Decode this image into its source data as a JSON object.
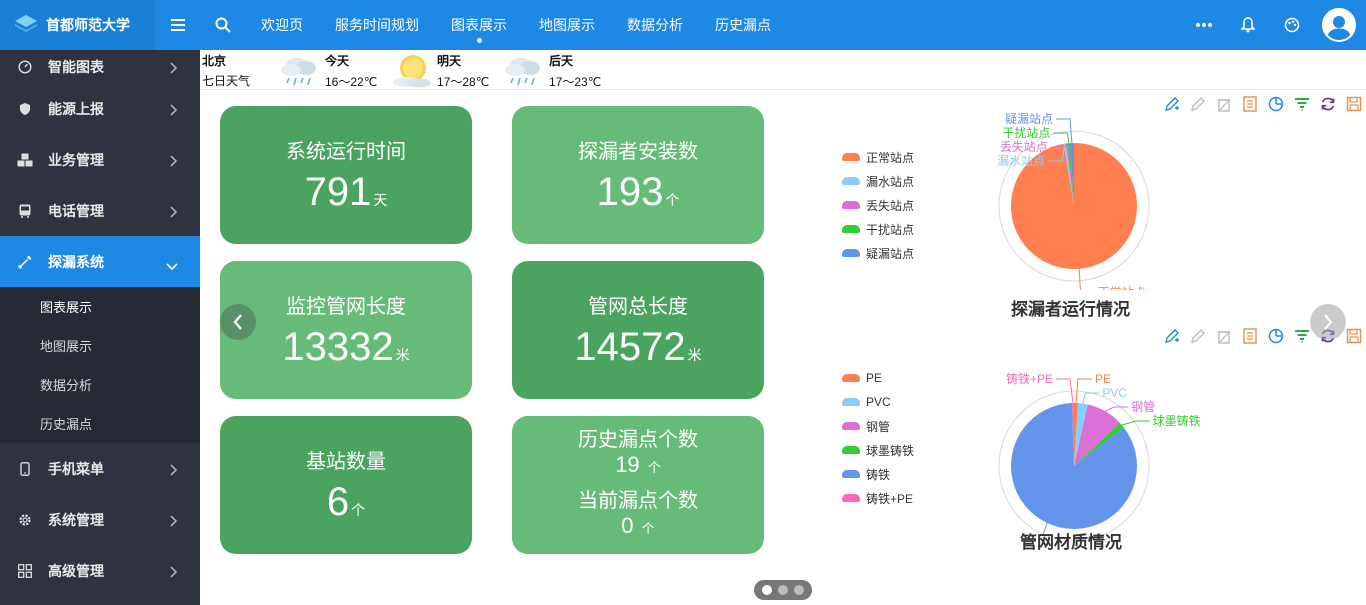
{
  "brand": {
    "name": "首都师范大学"
  },
  "nav": [
    {
      "label": "欢迎页"
    },
    {
      "label": "服务时间规划"
    },
    {
      "label": "图表展示",
      "active": true
    },
    {
      "label": "地图展示"
    },
    {
      "label": "数据分析"
    },
    {
      "label": "历史漏点"
    }
  ],
  "sidebar": {
    "items": [
      {
        "label": "智能图表",
        "icon": "gauge-icon"
      },
      {
        "label": "能源上报",
        "icon": "shield-icon"
      },
      {
        "label": "业务管理",
        "icon": "cubes-icon"
      },
      {
        "label": "电话管理",
        "icon": "bus-icon"
      },
      {
        "label": "探漏系统",
        "icon": "wrench-icon",
        "active": true
      },
      {
        "label": "手机菜单",
        "icon": "mobile-icon"
      },
      {
        "label": "系统管理",
        "icon": "gear-icon"
      },
      {
        "label": "高级管理",
        "icon": "grid-icon"
      }
    ],
    "sub_items": [
      {
        "label": "图表展示",
        "current": true
      },
      {
        "label": "地图展示"
      },
      {
        "label": "数据分析"
      },
      {
        "label": "历史漏点"
      }
    ]
  },
  "weather": {
    "city": "北京",
    "subtitle": "七日天气",
    "days": [
      {
        "name": "今天",
        "temp": "16～22℃",
        "icon": "rain-cloud-icon"
      },
      {
        "name": "明天",
        "temp": "17～28℃",
        "icon": "sun-cloud-icon"
      },
      {
        "name": "后天",
        "temp": "17～23℃",
        "icon": "rain-cloud-icon"
      }
    ]
  },
  "cards": {
    "uptime": {
      "title": "系统运行时间",
      "value": "791",
      "unit": "天"
    },
    "installs": {
      "title": "探漏者安装数",
      "value": "193",
      "unit": "个"
    },
    "monitor_length": {
      "title": "监控管网长度",
      "value": "13332",
      "unit": "米"
    },
    "total_length": {
      "title": "管网总长度",
      "value": "14572",
      "unit": "米"
    },
    "stations": {
      "title": "基站数量",
      "value": "6",
      "unit": "个"
    },
    "leaks": {
      "history_title": "历史漏点个数",
      "history_value": "19",
      "history_unit": "个",
      "current_title": "当前漏点个数",
      "current_value": "0",
      "current_unit": "个"
    }
  },
  "colors": {
    "topbar": "#1e88e5",
    "card_dark": "#4aa460",
    "card_light": "#66bb78"
  },
  "chart_data": [
    {
      "type": "pie",
      "title": "探漏者运行情况",
      "categories": [
        "正常站点",
        "漏水站点",
        "丢失站点",
        "干扰站点",
        "疑漏站点"
      ],
      "values": [
        188,
        1,
        1,
        1,
        2
      ],
      "colors": [
        "#ff7f50",
        "#87cefa",
        "#da70d6",
        "#32cd32",
        "#6495ed"
      ],
      "legend": "left"
    },
    {
      "type": "pie",
      "title": "管网材质情况",
      "categories": [
        "PE",
        "PVC",
        "钢管",
        "球墨铸铁",
        "铸铁",
        "铸铁+PE"
      ],
      "values": [
        1.0,
        2.5,
        9.5,
        1.5,
        85.0,
        0.5
      ],
      "colors": [
        "#ff7f50",
        "#87cefa",
        "#da70d6",
        "#32cd32",
        "#6495ed",
        "#ff69b4"
      ],
      "legend": "left"
    }
  ]
}
